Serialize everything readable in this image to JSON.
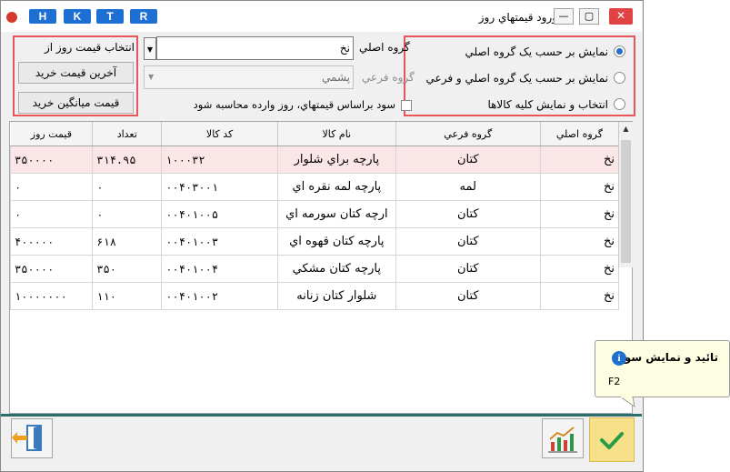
{
  "window": {
    "title": "ورود قيمتهاي روز",
    "shortcut_buttons": [
      "H",
      "K",
      "T",
      "R"
    ],
    "control_glyphs": {
      "minimize": "—",
      "maximize": "▢",
      "close": "✕"
    }
  },
  "display_options": {
    "options": [
      {
        "label": "نمايش بر حسب يک گروه اصلي",
        "selected": true
      },
      {
        "label": "نمايش بر حسب يک گروه اصلي و فرعي",
        "selected": false
      },
      {
        "label": "انتخاب و نمايش کليه کالاها",
        "selected": false
      }
    ]
  },
  "filters": {
    "main_group_label": "گروه اصلي",
    "main_group_value": "نخ",
    "sub_group_label": "گروه فرعي",
    "sub_group_value": "پشمي",
    "profit_checkbox_label": "سود براساس قيمتهاي، روز وارده محاسبه شود",
    "profit_checkbox_checked": false
  },
  "price_source": {
    "heading": "انتخاب قيمت روز از",
    "last_purchase_label": "آخرين قيمت خريد",
    "avg_purchase_label": "قيمت ميانگين خريد"
  },
  "table": {
    "headers": [
      "گروه اصلي",
      "گروه فرعي",
      "نام کالا",
      "کد کالا",
      "تعداد",
      "قيمت روز"
    ],
    "rows": [
      [
        "نخ",
        "کتان",
        "پارچه براي شلوار",
        "۱۰۰۰۳۲",
        "۳۱۴.۹۵",
        "۳۵۰۰۰۰"
      ],
      [
        "نخ",
        "لمه",
        "پارچه لمه نقره اي",
        "۰۰۴۰۳۰۰۱",
        "۰",
        "۰"
      ],
      [
        "نخ",
        "کتان",
        "ارچه کتان سورمه اي",
        "۰۰۴۰۱۰۰۵",
        "۰",
        "۰"
      ],
      [
        "نخ",
        "کتان",
        "پارچه کتان قهوه اي",
        "۰۰۴۰۱۰۰۳",
        "۶۱۸",
        "۴۰۰۰۰۰"
      ],
      [
        "نخ",
        "کتان",
        "پارچه کتان مشکي",
        "۰۰۴۰۱۰۰۴",
        "۳۵۰",
        "۳۵۰۰۰۰"
      ],
      [
        "نخ",
        "کتان",
        "شلوار کتان زنانه",
        "۰۰۴۰۱۰۰۲",
        "۱۱۰",
        "۱۰۰۰۰۰۰۰"
      ]
    ],
    "selected_row": 0
  },
  "tooltip": {
    "title": "تائيد و نمايش سود",
    "shortcut": "F2"
  },
  "footer": {
    "exit_icon": "exit-door-icon",
    "chart_icon": "chart-icon",
    "confirm_icon": "checkmark-icon"
  },
  "colors": {
    "highlight_box": "#e8555a",
    "title_button": "#1e6fd4",
    "close_button": "#e04343",
    "selected_row": "#fbe6e7",
    "confirm_button": "#f6e08a",
    "divider": "#2b6f6a",
    "checkmark": "#2a9a44"
  }
}
